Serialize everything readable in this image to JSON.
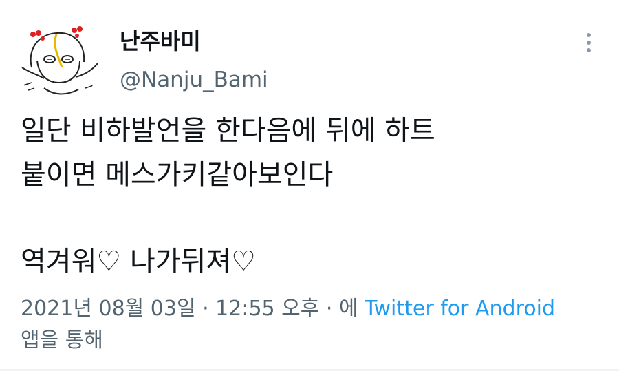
{
  "user": {
    "display_name": "난주바미",
    "handle": "@Nanju_Bami",
    "avatar_icon": "doodle-avatar-icon"
  },
  "more_icon": "more-vertical-icon",
  "tweet": {
    "lines": [
      "일단 비하발언을 한다음에 뒤에 하트",
      "붙이면 메스가키같아보인다",
      "역겨워♡ 나가뒤져♡"
    ]
  },
  "meta": {
    "timestamp": "2021년 08월 03일 · 12:55 오후 · 에 ",
    "source": "Twitter for Android",
    "suffix": "앱을 통해"
  },
  "colors": {
    "text": "#0f1419",
    "secondary": "#536471",
    "link": "#1d9bf0"
  }
}
